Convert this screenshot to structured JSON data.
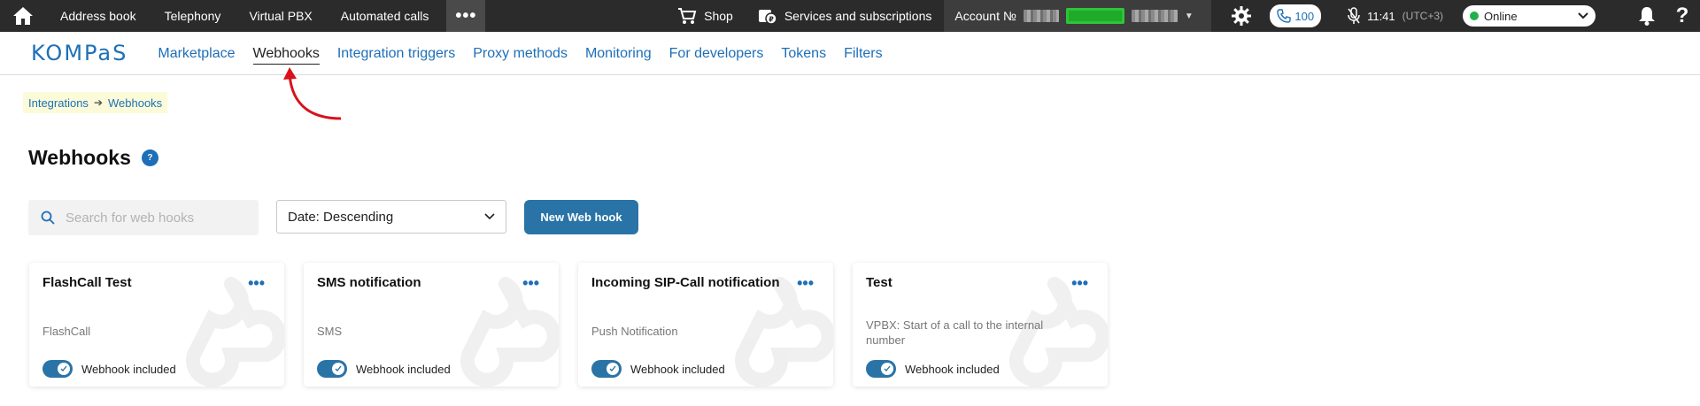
{
  "topbar": {
    "links": [
      "Address book",
      "Telephony",
      "Virtual PBX",
      "Automated calls"
    ],
    "more_label": "•••",
    "shop_label": "Shop",
    "services_label": "Services and subscriptions",
    "account_label": "Account №",
    "calls_count": "100",
    "time": "11:41",
    "timezone": "(UTC+3)",
    "status": "Online"
  },
  "logo": "KOMPaS",
  "tabs": [
    "Marketplace",
    "Webhooks",
    "Integration triggers",
    "Proxy methods",
    "Monitoring",
    "For developers",
    "Tokens",
    "Filters"
  ],
  "active_tab": "Webhooks",
  "breadcrumb": {
    "parent": "Integrations",
    "current": "Webhooks"
  },
  "page_title": "Webhooks",
  "help_badge": "?",
  "search": {
    "placeholder": "Search for web hooks"
  },
  "sort": {
    "value": "Date: Descending"
  },
  "new_button": "New Web hook",
  "cards": [
    {
      "title": "FlashCall Test",
      "type": "FlashCall",
      "toggle_label": "Webhook included"
    },
    {
      "title": "SMS notification",
      "type": "SMS",
      "toggle_label": "Webhook included"
    },
    {
      "title": "Incoming SIP-Call notification",
      "type": "Push Notification",
      "toggle_label": "Webhook included"
    },
    {
      "title": "Test",
      "type": "VPBX: Start of a call to the internal number",
      "toggle_label": "Webhook included"
    }
  ],
  "colors": {
    "accent": "#1d6fb8",
    "button": "#2a73a6",
    "topbar": "#2b2b2b",
    "online": "#21b04b"
  },
  "icons": {
    "home": "home-icon",
    "cart": "cart-icon",
    "services": "services-icon",
    "gear": "gear-icon",
    "phone": "phone-icon",
    "mic": "microphone-icon",
    "bell": "bell-icon",
    "help": "help-icon",
    "search": "search-icon",
    "chevron": "chevron-down-icon",
    "more": "more-dots-icon",
    "webhook": "webhook-icon",
    "check": "check-icon"
  }
}
